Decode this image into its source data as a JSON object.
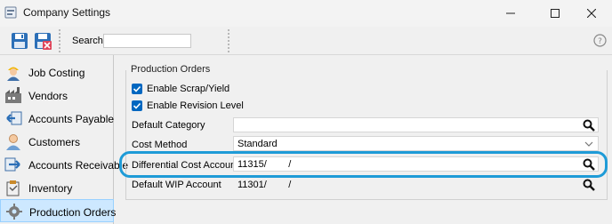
{
  "window": {
    "title": "Company Settings",
    "icon": "settings-app-icon",
    "controls": [
      "minimize-icon",
      "maximize-icon",
      "close-icon"
    ]
  },
  "toolbar": {
    "search_label": "Search",
    "search_value": "",
    "icons": [
      "save-icon",
      "save-close-icon",
      "help-icon"
    ]
  },
  "sidebar": {
    "items": [
      {
        "label": "Job Costing",
        "icon": "worker-icon"
      },
      {
        "label": "Vendors",
        "icon": "factory-icon"
      },
      {
        "label": "Accounts Payable",
        "icon": "payable-arrow-icon"
      },
      {
        "label": "Customers",
        "icon": "customer-icon"
      },
      {
        "label": "Accounts Receivable",
        "icon": "receivable-arrow-icon"
      },
      {
        "label": "Inventory",
        "icon": "inventory-icon"
      },
      {
        "label": "Production Orders",
        "icon": "production-gear-icon",
        "selected": true
      }
    ]
  },
  "main": {
    "group_title": "Production Orders",
    "checkboxes": [
      {
        "label": "Enable Scrap/Yield",
        "checked": true
      },
      {
        "label": "Enable Revision Level",
        "checked": true
      }
    ],
    "fields": {
      "default_category": {
        "label": "Default Category",
        "value": ""
      },
      "cost_method": {
        "label": "Cost Method",
        "value": "Standard"
      },
      "differential_cost_account": {
        "label": "Differential Cost Account",
        "value": "11315/        /"
      },
      "default_wip_account": {
        "label": "Default WIP Account",
        "value": "11301/        /"
      }
    }
  },
  "colors": {
    "accent": "#0067c0",
    "highlight": "#1e9bd7",
    "selected_bg": "#cde8ff"
  }
}
